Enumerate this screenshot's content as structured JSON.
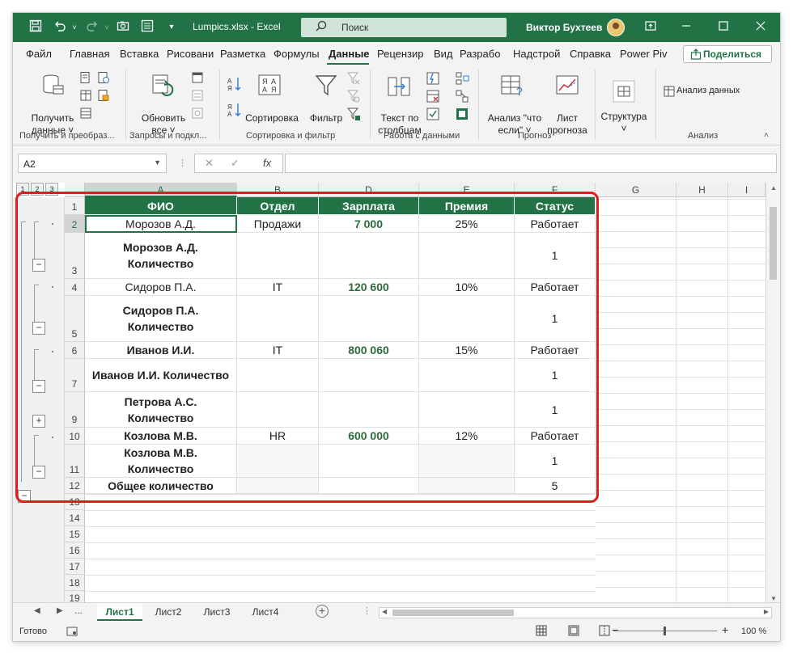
{
  "titlebar": {
    "file_name": "Lumpics.xlsx  -  Excel",
    "search_label": "Поиск",
    "user_name": "Виктор Бухтеев"
  },
  "tabs": [
    "Файл",
    "Главная",
    "Вставка",
    "Рисовани",
    "Разметка",
    "Формулы",
    "Данные",
    "Рецензир",
    "Вид",
    "Разрабо",
    "Надстрой",
    "Справка",
    "Power Piv"
  ],
  "share_label": "Поделиться",
  "ribbon": {
    "get_data": "Получить\nданные ˅",
    "refresh_all": "Обновить\nвсе ˅",
    "sort": "Сортировка",
    "filter": "Фильтр",
    "text_to_columns": "Текст по\nстолбцам",
    "what_if": "Анализ \"что\nесли\" ˅",
    "forecast": "Лист\nпрогноза",
    "structure": "Структура\n˅",
    "data_analysis": "Анализ данных",
    "groups": [
      "Получить и преобраз...",
      "Запросы и подкл...",
      "Сортировка и фильтр",
      "Работа с данными",
      "Прогноз",
      "Анализ"
    ]
  },
  "formula_bar": {
    "name_box": "A2",
    "fx": "fx"
  },
  "outline_levels": [
    "1",
    "2",
    "3"
  ],
  "columns": [
    "A",
    "B",
    "D",
    "E",
    "F",
    "G",
    "H",
    "I"
  ],
  "rows": [
    {
      "num": "1",
      "cells": [
        "ФИО",
        "Отдел",
        "Зарплата",
        "Премия",
        "Статус"
      ]
    },
    {
      "num": "2",
      "cells": [
        "Морозов А.Д.",
        "Продажи",
        "7 000",
        "25%",
        "Работает"
      ]
    },
    {
      "num": "3",
      "cells": [
        "Морозов А.Д. Количество",
        "",
        "",
        "",
        "1"
      ]
    },
    {
      "num": "4",
      "cells": [
        "Сидоров П.А.",
        "IT",
        "120 600",
        "10%",
        "Работает"
      ]
    },
    {
      "num": "5",
      "cells": [
        "Сидоров П.А. Количество",
        "",
        "",
        "",
        "1"
      ]
    },
    {
      "num": "6",
      "cells": [
        "Иванов И.И.",
        "IT",
        "800 060",
        "15%",
        "Работает"
      ]
    },
    {
      "num": "7",
      "cells": [
        "Иванов И.И. Количество",
        "",
        "",
        "",
        "1"
      ]
    },
    {
      "num": "9",
      "cells": [
        "Петрова А.С. Количество",
        "",
        "",
        "",
        "1"
      ]
    },
    {
      "num": "10",
      "cells": [
        "Козлова М.В.",
        "HR",
        "600 000",
        "12%",
        "Работает"
      ]
    },
    {
      "num": "11",
      "cells": [
        "Козлова М.В. Количество",
        "",
        "",
        "",
        "1"
      ]
    },
    {
      "num": "12",
      "cells": [
        "Общее количество",
        "",
        "",
        "",
        "5"
      ]
    },
    {
      "num": "13",
      "cells": [
        "",
        "",
        "",
        "",
        ""
      ]
    },
    {
      "num": "14",
      "cells": [
        "",
        "",
        "",
        "",
        ""
      ]
    },
    {
      "num": "15",
      "cells": [
        "",
        "",
        "",
        "",
        ""
      ]
    },
    {
      "num": "16",
      "cells": [
        "",
        "",
        "",
        "",
        ""
      ]
    },
    {
      "num": "17",
      "cells": [
        "",
        "",
        "",
        "",
        ""
      ]
    },
    {
      "num": "18",
      "cells": [
        "",
        "",
        "",
        "",
        ""
      ]
    },
    {
      "num": "19",
      "cells": [
        "",
        "",
        "",
        "",
        ""
      ]
    }
  ],
  "sheets": [
    "Лист1",
    "Лист2",
    "Лист3",
    "Лист4"
  ],
  "status": {
    "ready": "Готово",
    "zoom": "100 %"
  },
  "colors": {
    "excel_green": "#217346",
    "highlight_frame": "#e21c1c"
  }
}
